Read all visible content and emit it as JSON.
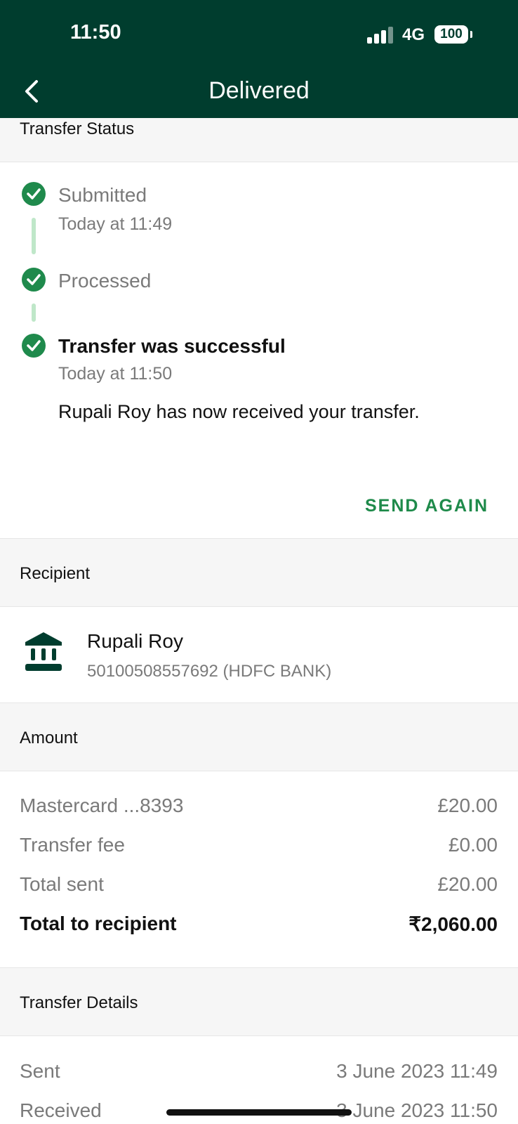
{
  "status_bar": {
    "time": "11:50",
    "network": "4G",
    "battery": "100"
  },
  "header": {
    "title": "Delivered"
  },
  "transfer_status": {
    "heading": "Transfer Status",
    "steps": [
      {
        "label": "Submitted",
        "time": "Today at 11:49"
      },
      {
        "label": "Processed"
      },
      {
        "label": "Transfer was successful",
        "time": "Today at 11:50",
        "message": "Rupali Roy has now received your transfer."
      }
    ],
    "send_again_label": "SEND AGAIN"
  },
  "recipient": {
    "heading": "Recipient",
    "name": "Rupali Roy",
    "account": "50100508557692 (HDFC BANK)"
  },
  "amount": {
    "heading": "Amount",
    "rows": [
      {
        "label": "Mastercard ...8393",
        "value": "£20.00"
      },
      {
        "label": "Transfer fee",
        "value": "£0.00"
      },
      {
        "label": "Total sent",
        "value": "£20.00"
      },
      {
        "label": "Total to recipient",
        "value": "₹2,060.00"
      }
    ]
  },
  "transfer_details": {
    "heading": "Transfer Details",
    "rows": [
      {
        "label": "Sent",
        "value": "3 June 2023 11:49"
      },
      {
        "label": "Received",
        "value": "3 June 2023 11:50"
      }
    ]
  },
  "colors": {
    "header_bg": "#003d2e",
    "accent_green": "#1e8a4a",
    "check_green": "#1f8a4c"
  },
  "icons": {
    "back": "chevron-left-icon",
    "check": "check-circle-icon",
    "bank": "bank-icon"
  }
}
